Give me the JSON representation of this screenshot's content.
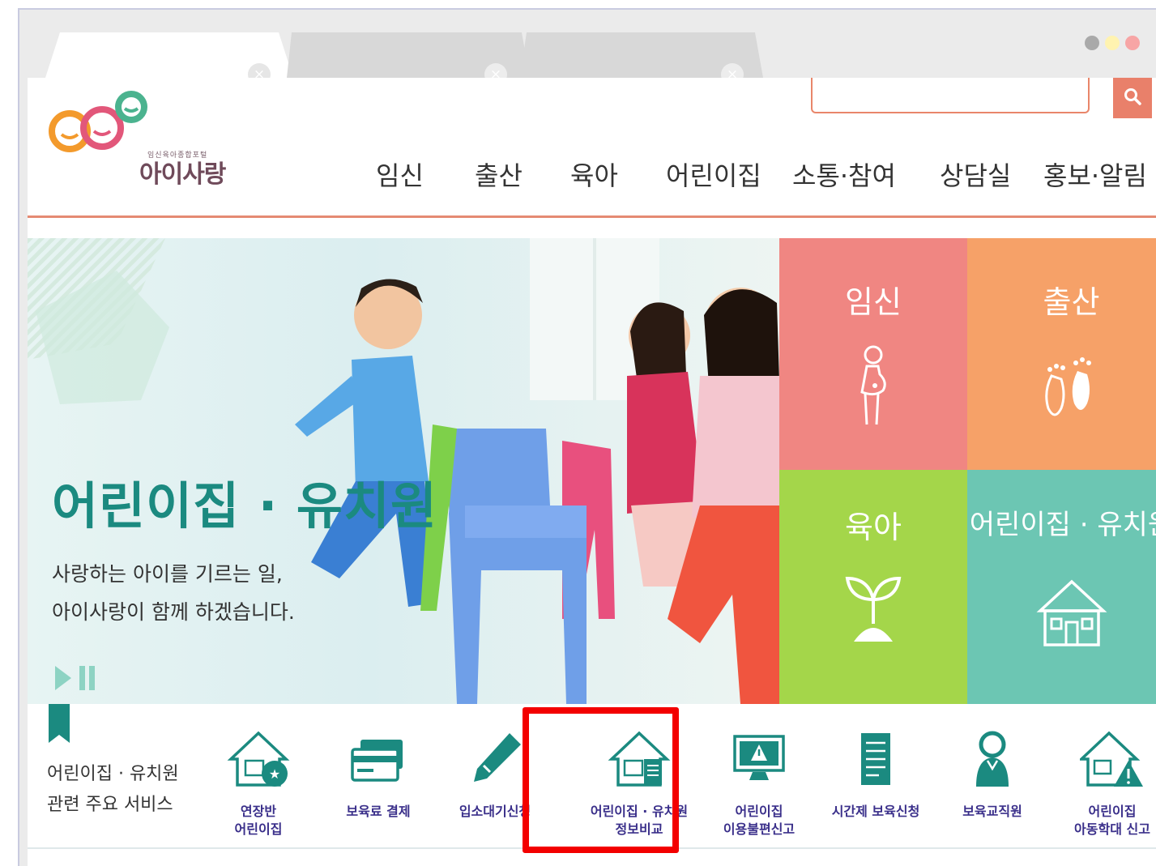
{
  "browser": {
    "tabs": [
      {
        "close": "×"
      },
      {
        "close": "×"
      },
      {
        "close": "×"
      }
    ],
    "window_dots": [
      "#a9a9a9",
      "#fff3b0",
      "#f7a5a5"
    ]
  },
  "header": {
    "logo_sub": "임신육아종합포털",
    "logo_name": "아이사랑",
    "search_icon": "search-icon",
    "nav": [
      "임신",
      "출산",
      "육아",
      "어린이집",
      "소통·참여",
      "상담실",
      "홍보·알림"
    ]
  },
  "hero": {
    "title": "어린이집 · 유치원",
    "subtitle_line1": "사랑하는 아이를 기르는 일,",
    "subtitle_line2": "아이사랑이 함께 하겠습니다."
  },
  "tiles": [
    {
      "label": "임신",
      "icon": "pregnant-woman-icon",
      "color": "#f08682"
    },
    {
      "label": "출산",
      "icon": "footprint-icon",
      "color": "#f6a168"
    },
    {
      "label": "육아",
      "icon": "sprout-icon",
      "color": "#a4d64a"
    },
    {
      "label": "어린이집 · 유치원",
      "icon": "school-house-icon",
      "color": "#6cc6b3"
    }
  ],
  "services": {
    "title_line1": "어린이집 · 유치원",
    "title_line2": "관련 주요 서비스",
    "items": [
      {
        "line1": "연장반",
        "line2": "어린이집",
        "icon": "house-star-icon"
      },
      {
        "line1": "보육료 결제",
        "line2": "",
        "icon": "credit-card-icon"
      },
      {
        "line1": "입소대기신청",
        "line2": "",
        "icon": "pencil-icon"
      },
      {
        "line1": "어린이집 · 유치원",
        "line2": "정보비교",
        "icon": "house-document-icon"
      },
      {
        "line1": "어린이집",
        "line2": "이용불편신고",
        "icon": "monitor-alert-icon"
      },
      {
        "line1": "시간제 보육신청",
        "line2": "",
        "icon": "document-icon"
      },
      {
        "line1": "보육교직원",
        "line2": "",
        "icon": "staff-person-icon"
      },
      {
        "line1": "어린이집",
        "line2": "아동학대 신고",
        "icon": "house-warning-icon"
      }
    ]
  },
  "colors": {
    "accent": "#e9806a",
    "hero_title": "#1b8a80",
    "service_label": "#3a2f8a",
    "highlight": "#f30000"
  }
}
